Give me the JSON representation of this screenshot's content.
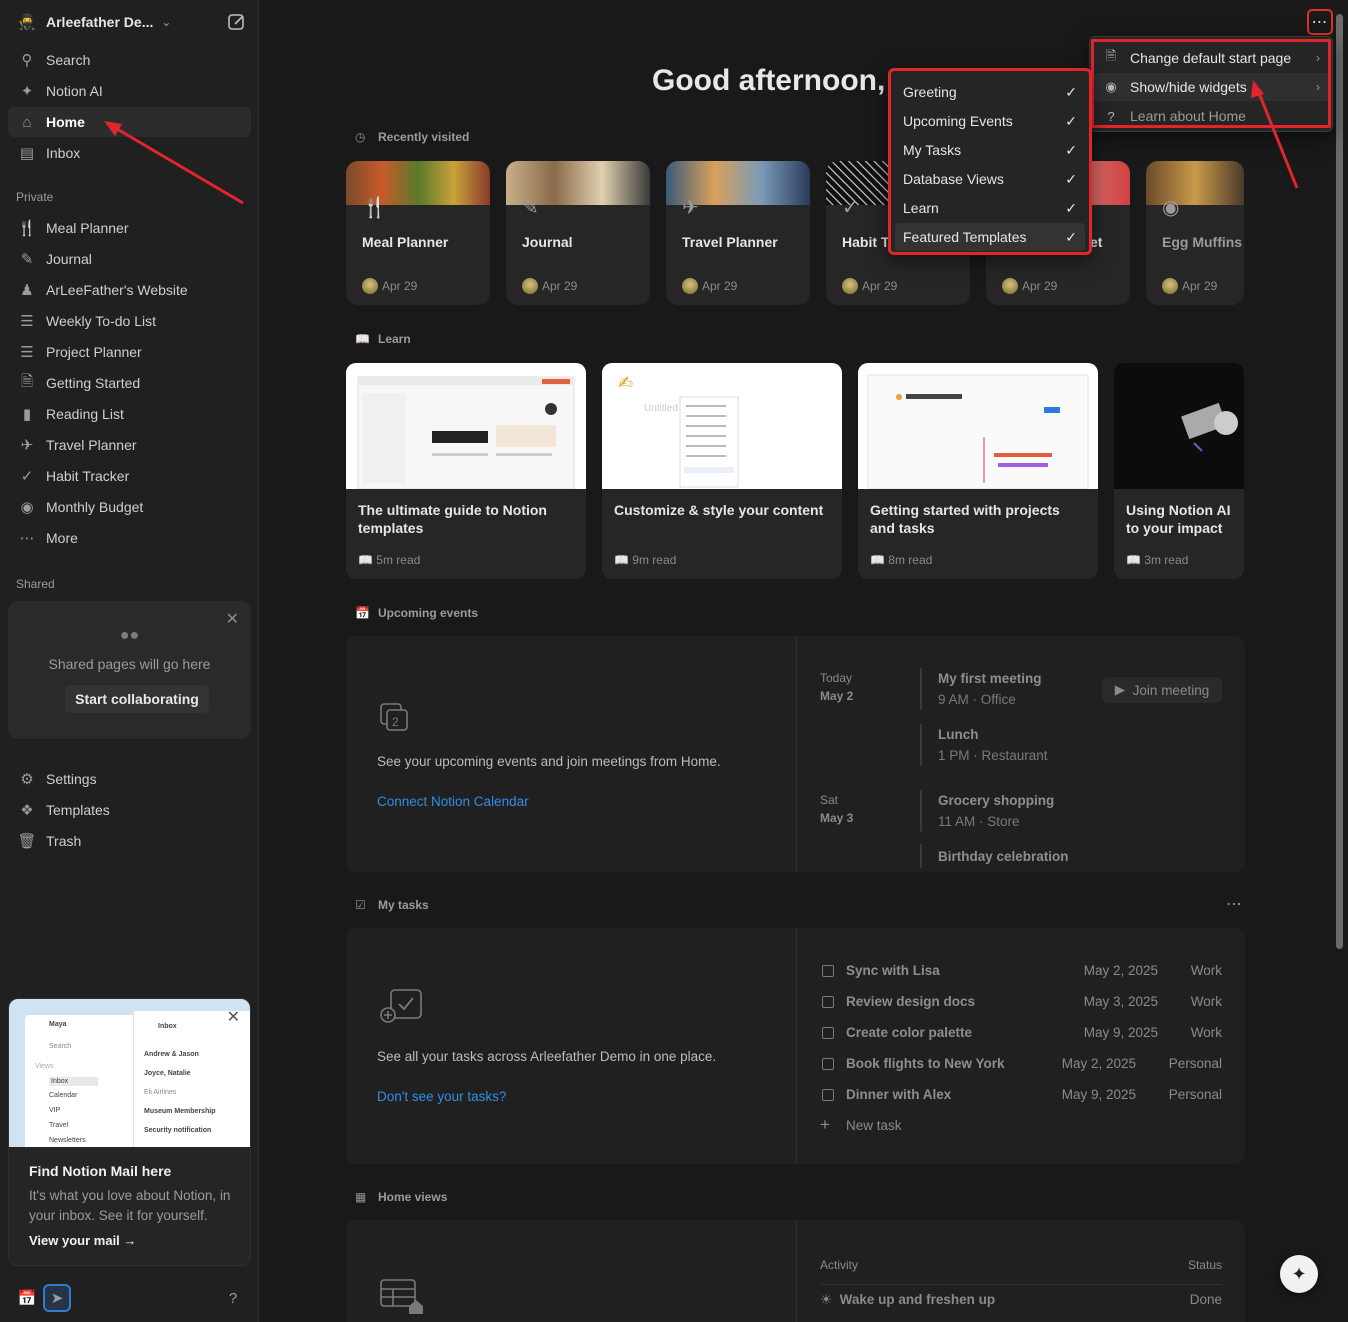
{
  "workspace": {
    "name": "Arleefather De...",
    "icon": "🥷"
  },
  "sidebar": {
    "top_items": [
      {
        "label": "Search",
        "icon": "search-icon"
      },
      {
        "label": "Notion AI",
        "icon": "notion-ai-icon"
      },
      {
        "label": "Home",
        "icon": "home-icon",
        "active": true
      },
      {
        "label": "Inbox",
        "icon": "inbox-icon"
      }
    ],
    "private_label": "Private",
    "private_items": [
      {
        "label": "Meal Planner"
      },
      {
        "label": "Journal"
      },
      {
        "label": "ArLeeFather's Website"
      },
      {
        "label": "Weekly To-do List"
      },
      {
        "label": "Project Planner"
      },
      {
        "label": "Getting Started"
      },
      {
        "label": "Reading List"
      },
      {
        "label": "Travel Planner"
      },
      {
        "label": "Habit Tracker"
      },
      {
        "label": "Monthly Budget"
      },
      {
        "label": "More"
      }
    ],
    "shared_label": "Shared",
    "shared_card": {
      "message": "Shared pages will go here",
      "button": "Start collaborating"
    },
    "bottom_items": [
      {
        "label": "Settings"
      },
      {
        "label": "Templates"
      },
      {
        "label": "Trash"
      }
    ],
    "mail_card": {
      "title": "Find Notion Mail here",
      "description": "It's what you love about Notion, in your inbox. See it for yourself.",
      "link": "View your mail",
      "preview": {
        "user": "Maya",
        "search": "Search",
        "views": "Views",
        "items": [
          "Inbox",
          "Calendar",
          "VIP",
          "Travel",
          "Newsletters"
        ],
        "inbox_title": "Inbox",
        "senders": [
          "Andrew & Jason",
          "Joyce, Natalie",
          "Eli Airlines",
          "Museum Membership",
          "Security notification"
        ]
      }
    }
  },
  "main": {
    "greeting": "Good afternoon,",
    "recently_visited": {
      "label": "Recently visited",
      "cards": [
        {
          "title": "Meal Planner",
          "date": "Apr 29"
        },
        {
          "title": "Journal",
          "date": "Apr 29"
        },
        {
          "title": "Travel Planner",
          "date": "Apr 29"
        },
        {
          "title": "Habit T",
          "date": "Apr 29"
        },
        {
          "title": "et",
          "date": "Apr 29"
        },
        {
          "title": "Egg Muffins",
          "date": "Apr 29"
        }
      ]
    },
    "learn": {
      "label": "Learn",
      "cards": [
        {
          "title": "The ultimate guide to Notion templates",
          "time": "5m read"
        },
        {
          "title": "Customize & style your content",
          "time": "9m read"
        },
        {
          "title": "Getting started with projects and tasks",
          "time": "8m read"
        },
        {
          "title": "Using Notion AI to your impact",
          "time": "3m read"
        }
      ]
    },
    "upcoming_events": {
      "label": "Upcoming events",
      "description": "See your upcoming events and join meetings from Home.",
      "link": "Connect Notion Calendar",
      "days": [
        {
          "day": "Today",
          "date": "May 2"
        },
        {
          "day": "Sat",
          "date": "May 3"
        }
      ],
      "events": [
        {
          "title": "My first meeting",
          "sub": "9 AM · Office"
        },
        {
          "title": "Lunch",
          "sub": "1 PM · Restaurant"
        },
        {
          "title": "Grocery shopping",
          "sub": "11 AM · Store"
        },
        {
          "title": "Birthday celebration",
          "sub": ""
        }
      ],
      "join_label": "Join meeting"
    },
    "my_tasks": {
      "label": "My tasks",
      "description": "See all your tasks across Arleefather Demo in one place.",
      "link": "Don't see your tasks?",
      "tasks": [
        {
          "title": "Sync with Lisa",
          "date": "May 2, 2025",
          "tag": "Work"
        },
        {
          "title": "Review design docs",
          "date": "May 3, 2025",
          "tag": "Work"
        },
        {
          "title": "Create color palette",
          "date": "May 9, 2025",
          "tag": "Work"
        },
        {
          "title": "Book flights to New York",
          "date": "May 2, 2025",
          "tag": "Personal"
        },
        {
          "title": "Dinner with Alex",
          "date": "May 9, 2025",
          "tag": "Personal"
        }
      ],
      "new_task": "New task"
    },
    "home_views": {
      "label": "Home views",
      "columns": [
        "Activity",
        "Status"
      ],
      "rows": [
        {
          "activity": "Wake up and freshen up",
          "status": "Done"
        }
      ]
    }
  },
  "context_menu": {
    "items": [
      {
        "label": "Change default start page",
        "icon": "page-icon"
      },
      {
        "label": "Show/hide widgets",
        "icon": "eye-icon"
      },
      {
        "label": "Learn about Home",
        "icon": "help-icon"
      }
    ]
  },
  "widgets_menu": {
    "items": [
      {
        "label": "Greeting",
        "checked": true
      },
      {
        "label": "Upcoming Events",
        "checked": true
      },
      {
        "label": "My Tasks",
        "checked": true
      },
      {
        "label": "Database Views",
        "checked": true
      },
      {
        "label": "Learn",
        "checked": true
      },
      {
        "label": "Featured Templates",
        "checked": true
      }
    ]
  },
  "colors": {
    "annotation_red": "#e0262b",
    "link_blue": "#2e8fe6",
    "background": "#191919",
    "sidebar": "#202020"
  }
}
